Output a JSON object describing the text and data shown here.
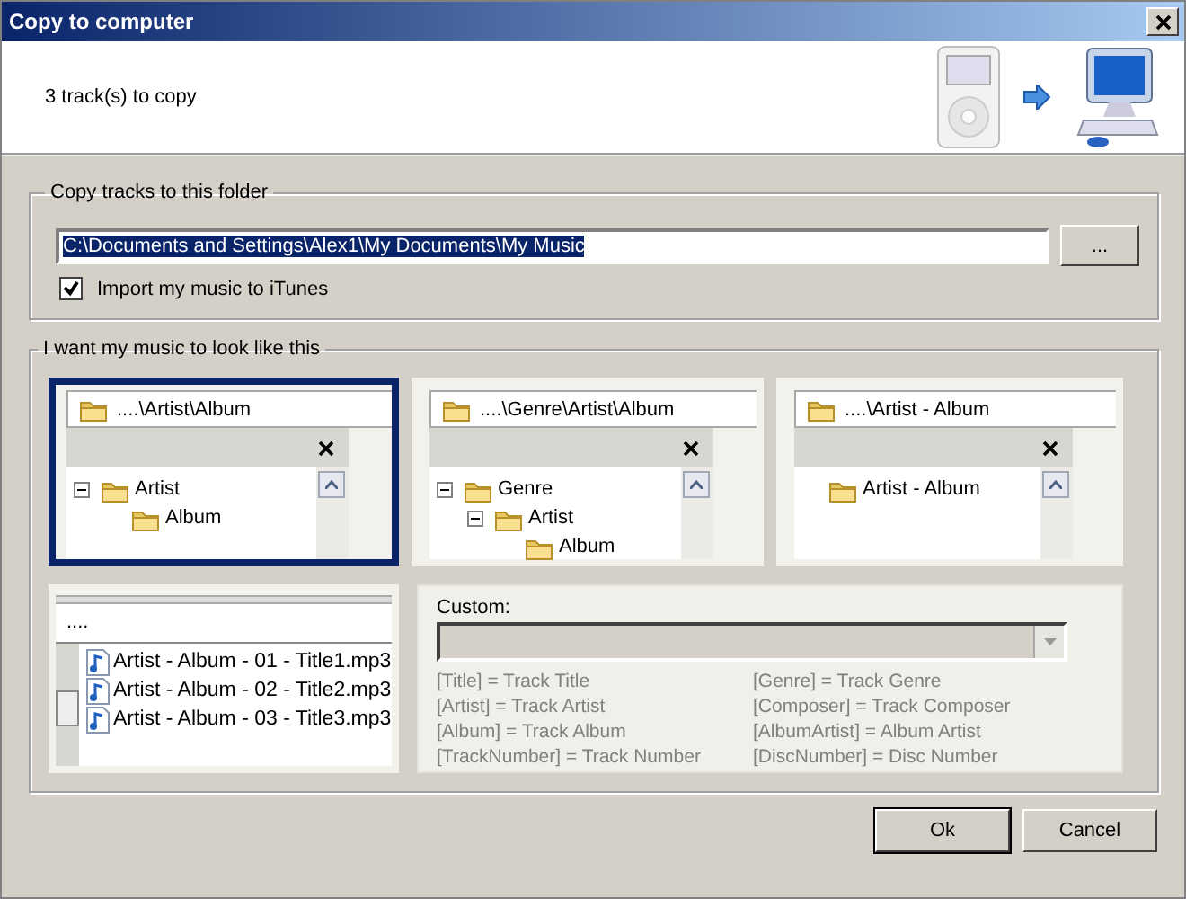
{
  "window": {
    "title": "Copy to computer"
  },
  "header": {
    "message": "3 track(s) to copy"
  },
  "folder_group": {
    "legend": "Copy tracks to this folder",
    "path": "C:\\Documents and Settings\\Alex1\\My Documents\\My Music",
    "browse_button": "...",
    "import_itunes": {
      "label": "Import my music to iTunes",
      "checked": true
    }
  },
  "layout_group": {
    "legend": "I want my music to look like this",
    "options": [
      {
        "path": "....\\Artist\\Album",
        "selected": true,
        "tree": [
          {
            "label": "Artist",
            "expanded": true,
            "children": [
              {
                "label": "Album"
              }
            ]
          }
        ]
      },
      {
        "path": "....\\Genre\\Artist\\Album",
        "selected": false,
        "tree": [
          {
            "label": "Genre",
            "expanded": true,
            "children": [
              {
                "label": "Artist",
                "expanded": true,
                "children": [
                  {
                    "label": "Album"
                  }
                ]
              }
            ]
          }
        ]
      },
      {
        "path": "....\\Artist - Album",
        "selected": false,
        "tree": [
          {
            "label": "Artist - Album"
          }
        ]
      }
    ],
    "file_preview": {
      "path": "....",
      "files": [
        "Artist - Album - 01 - Title1.mp3",
        "Artist - Album - 02 - Title2.mp3",
        "Artist - Album - 03 - Title3.mp3"
      ]
    },
    "custom": {
      "label": "Custom:",
      "dropdown": {
        "disabled": true
      },
      "columns": [
        [
          "[Title] = Track Title",
          "[Artist] = Track Artist",
          "[Album] = Track Album",
          "[TrackNumber] = Track Number"
        ],
        [
          "[Genre] = Track Genre",
          "[Composer] = Track Composer",
          "[AlbumArtist] = Album Artist",
          "[DiscNumber] = Disc Number"
        ]
      ]
    }
  },
  "buttons": [
    "Ok",
    "Cancel"
  ]
}
